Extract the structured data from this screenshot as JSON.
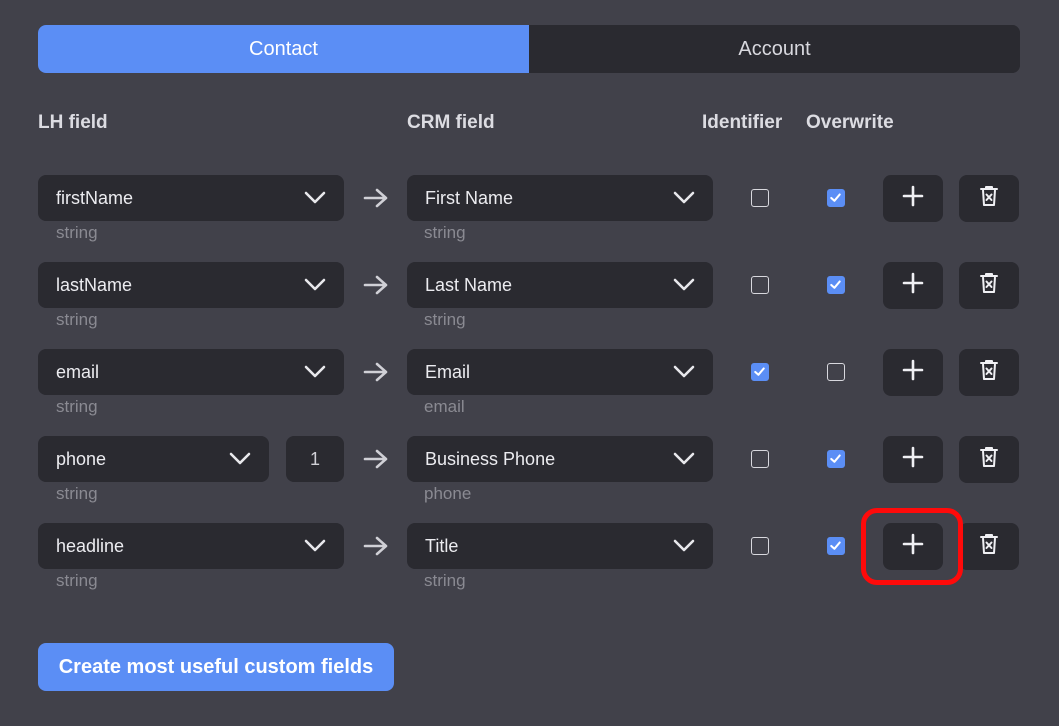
{
  "tabs": [
    {
      "label": "Contact",
      "active": true
    },
    {
      "label": "Account",
      "active": false
    }
  ],
  "headers": {
    "lh_field": "LH field",
    "crm_field": "CRM field",
    "identifier": "Identifier",
    "overwrite": "Overwrite"
  },
  "rows": [
    {
      "lh_field": "firstName",
      "lh_type": "string",
      "crm_field": "First Name",
      "crm_type": "string",
      "identifier": false,
      "overwrite": true
    },
    {
      "lh_field": "lastName",
      "lh_type": "string",
      "crm_field": "Last Name",
      "crm_type": "string",
      "identifier": false,
      "overwrite": true
    },
    {
      "lh_field": "email",
      "lh_type": "string",
      "crm_field": "Email",
      "crm_type": "email",
      "identifier": true,
      "overwrite": false
    },
    {
      "lh_field": "phone",
      "lh_index": "1",
      "lh_type": "string",
      "crm_field": "Business Phone",
      "crm_type": "phone",
      "identifier": false,
      "overwrite": true
    },
    {
      "lh_field": "headline",
      "lh_type": "string",
      "crm_field": "Title",
      "crm_type": "string",
      "identifier": false,
      "overwrite": true,
      "add_highlighted": true
    }
  ],
  "icons": {
    "dropdown": "chevron-down-icon",
    "mapping": "arrow-right-icon",
    "add": "plus-icon",
    "delete": "trash-icon",
    "checked": "check-icon"
  },
  "colors": {
    "accent": "#5b8ef5",
    "background": "#41414a",
    "control": "#2a2a30",
    "highlight": "#ff0a0a"
  },
  "create_button_label": "Create most useful custom fields"
}
